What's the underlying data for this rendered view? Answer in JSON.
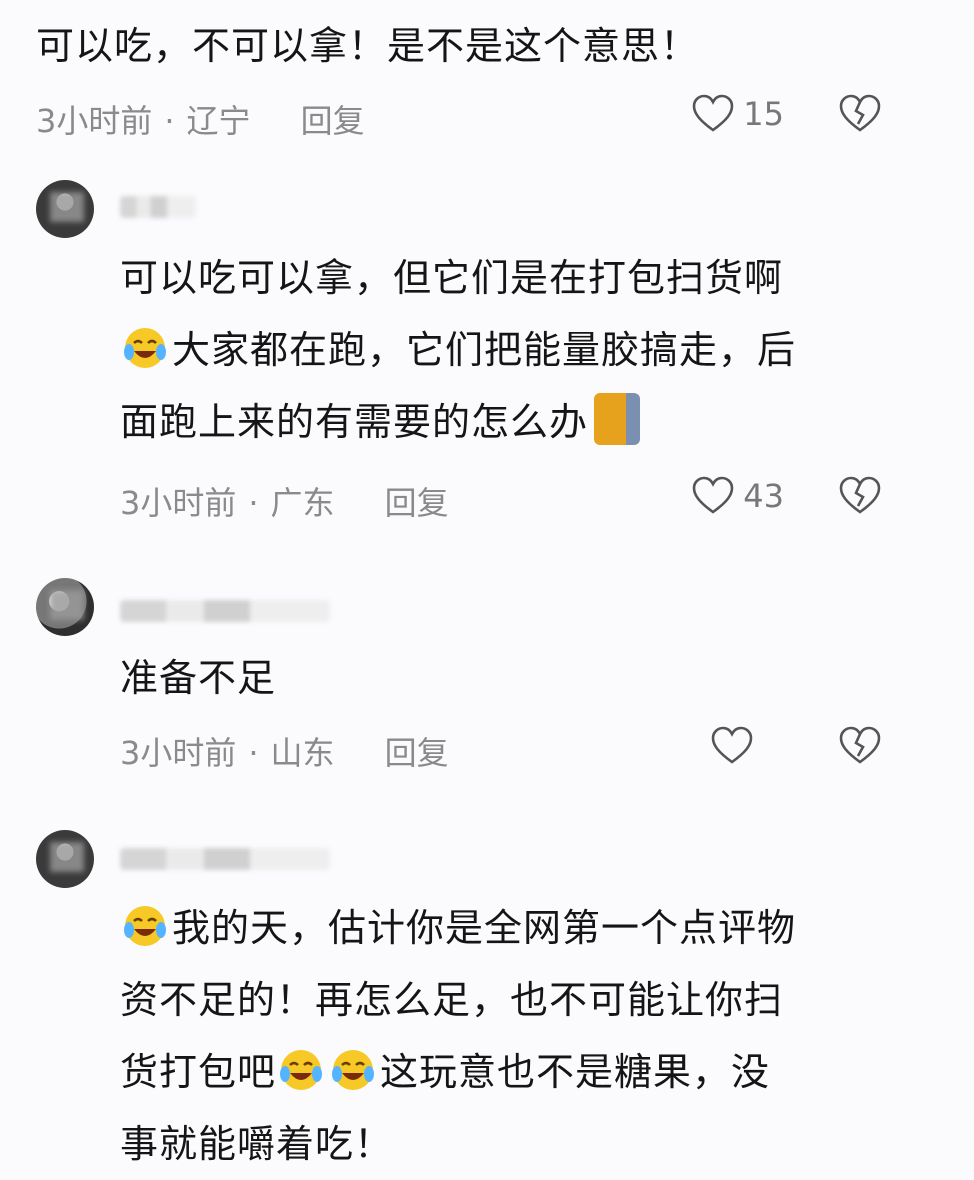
{
  "comments": [
    {
      "lines": [
        "可以吃，不可以拿！是不是这个意思！"
      ],
      "time": "3小时前",
      "separator": "·",
      "region": "辽宁",
      "reply": "回复",
      "likes": "15"
    },
    {
      "name_visible": "",
      "lines": [
        "可以吃可以拿，但它们是在打包扫货啊",
        "大家都在跑，它们把能量胶搞走，后",
        "面跑上来的有需要的怎么办"
      ],
      "time": "3小时前",
      "separator": "·",
      "region": "广东",
      "reply": "回复",
      "likes": "43"
    },
    {
      "lines": [
        "准备不足"
      ],
      "time": "3小时前",
      "separator": "·",
      "region": "山东",
      "reply": "回复",
      "likes": ""
    },
    {
      "lines": [
        "我的天，估计你是全网第一个点评物",
        "资不足的！再怎么足，也不可能让你扫",
        "货打包吧",
        "这玩意也不是糖果，没",
        "事就能嚼着吃！"
      ]
    }
  ],
  "icons": {
    "like": "heart-outline-icon",
    "dislike": "broken-heart-icon",
    "emoji": "laughing-tears-emoji-icon",
    "cat": "cat-emoji-icon"
  },
  "colors": {
    "text": "#151515",
    "meta": "#8a8a8a",
    "background": "#fbfafd"
  }
}
